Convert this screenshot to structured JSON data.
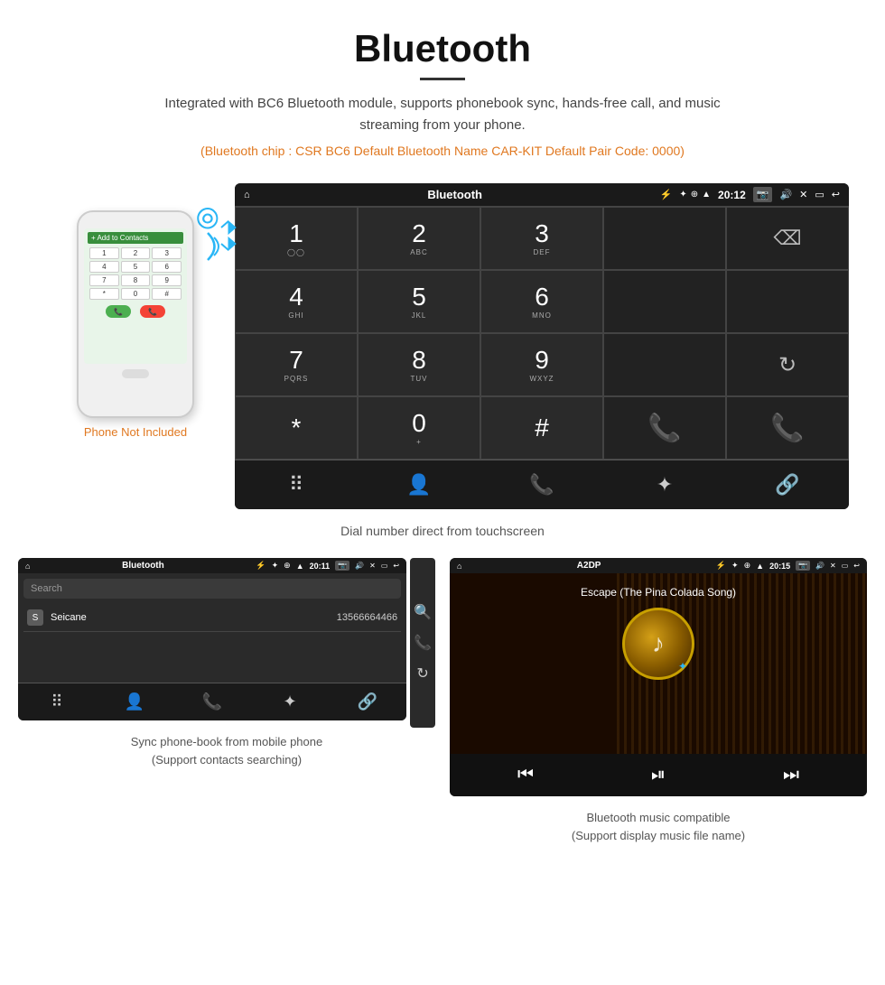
{
  "header": {
    "title": "Bluetooth",
    "description": "Integrated with BC6 Bluetooth module, supports phonebook sync, hands-free call, and music streaming from your phone.",
    "chip_info": "(Bluetooth chip : CSR BC6    Default Bluetooth Name CAR-KIT    Default Pair Code: 0000)"
  },
  "phone_section": {
    "not_included": "Phone Not Included",
    "screen_header": "+ Add to Contacts",
    "keypad_keys": [
      "1",
      "2",
      "3",
      "4",
      "5",
      "6",
      "7",
      "8",
      "9",
      "*",
      "0",
      "#"
    ]
  },
  "dialpad": {
    "status_bar": {
      "home": "⌂",
      "title": "Bluetooth",
      "usb": "⚡",
      "bt": "✦",
      "location": "⊕",
      "wifi": "▲",
      "time": "20:12",
      "camera": "📷",
      "volume": "🔊",
      "close": "✕",
      "window": "▭",
      "back": "↩"
    },
    "keys": [
      {
        "num": "1",
        "sub": "◯◯"
      },
      {
        "num": "2",
        "sub": "ABC"
      },
      {
        "num": "3",
        "sub": "DEF"
      },
      {
        "num": "",
        "sub": ""
      },
      {
        "num": "⌫",
        "sub": ""
      },
      {
        "num": "4",
        "sub": "GHI"
      },
      {
        "num": "5",
        "sub": "JKL"
      },
      {
        "num": "6",
        "sub": "MNO"
      },
      {
        "num": "",
        "sub": ""
      },
      {
        "num": "",
        "sub": ""
      },
      {
        "num": "7",
        "sub": "PQRS"
      },
      {
        "num": "8",
        "sub": "TUV"
      },
      {
        "num": "9",
        "sub": "WXYZ"
      },
      {
        "num": "",
        "sub": ""
      },
      {
        "num": "↻",
        "sub": ""
      },
      {
        "num": "*",
        "sub": ""
      },
      {
        "num": "0",
        "sub": "+"
      },
      {
        "num": "#",
        "sub": ""
      },
      {
        "num": "📞",
        "sub": "green"
      },
      {
        "num": "📞",
        "sub": "red"
      }
    ],
    "toolbar": [
      "⠿",
      "👤",
      "📞",
      "✦",
      "🔗"
    ],
    "caption": "Dial number direct from touchscreen"
  },
  "phonebook_screen": {
    "status_title": "Bluetooth",
    "status_time": "20:11",
    "search_placeholder": "Search",
    "entry": {
      "letter": "S",
      "name": "Seicane",
      "number": "13566664466"
    },
    "toolbar": [
      "⠿",
      "👤",
      "📞",
      "✦",
      "🔗"
    ],
    "side_icons": [
      "🔍",
      "📞",
      "↻"
    ],
    "caption": "Sync phone-book from mobile phone\n(Support contacts searching)"
  },
  "music_screen": {
    "status_title": "A2DP",
    "status_time": "20:15",
    "song_title": "Escape (The Pina Colada Song)",
    "controls": [
      "⏮",
      "⏯",
      "⏭"
    ],
    "caption": "Bluetooth music compatible\n(Support display music file name)"
  },
  "colors": {
    "accent_orange": "#e07820",
    "screen_bg": "#2a2a2a",
    "status_bg": "#1a1a1a",
    "bt_blue": "#29b6f6",
    "call_green": "#4caf50",
    "call_red": "#f44336"
  }
}
